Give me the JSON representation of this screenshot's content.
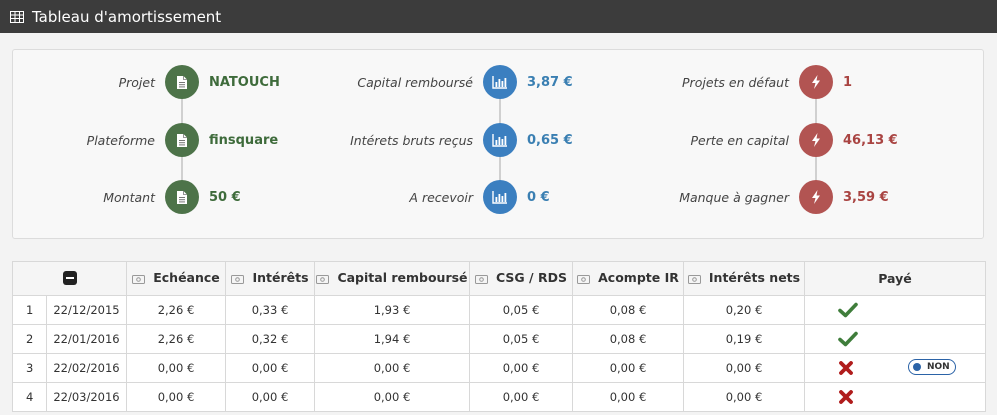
{
  "header": {
    "title": "Tableau d'amortissement"
  },
  "summary": {
    "columns": [
      {
        "color": "#4d7349",
        "value_color": "#3e6b3b",
        "icon": "document-icon",
        "items": [
          {
            "label": "Projet",
            "value": "NATOUCH"
          },
          {
            "label": "Plateforme",
            "value": "finsquare"
          },
          {
            "label": "Montant",
            "value": "50 €"
          }
        ]
      },
      {
        "color": "#3b7fc0",
        "value_color": "#3a7fb2",
        "icon": "bar-chart-icon",
        "items": [
          {
            "label": "Capital remboursé",
            "value": "3,87 €"
          },
          {
            "label": "Intérets bruts reçus",
            "value": "0,65 €"
          },
          {
            "label": "A recevoir",
            "value": "0 €"
          }
        ]
      },
      {
        "color": "#b25452",
        "value_color": "#a94442",
        "icon": "lightning-icon",
        "items": [
          {
            "label": "Projets en défaut",
            "value": "1"
          },
          {
            "label": "Perte en capital",
            "value": "46,13 €"
          },
          {
            "label": "Manque à gagner",
            "value": "3,59 €"
          }
        ]
      }
    ]
  },
  "table": {
    "headers": [
      "Echéance",
      "Intérêts",
      "Capital remboursé",
      "CSG / RDS",
      "Acompte IR",
      "Intérêts nets",
      "Payé"
    ],
    "rows": [
      {
        "n": "1",
        "date": "22/12/2015",
        "echeance": "2,26 €",
        "interets": "0,33 €",
        "capital": "1,93 €",
        "csg": "0,05 €",
        "acompte": "0,08 €",
        "nets": "0,20 €",
        "paid": true
      },
      {
        "n": "2",
        "date": "22/01/2016",
        "echeance": "2,26 €",
        "interets": "0,32 €",
        "capital": "1,94 €",
        "csg": "0,05 €",
        "acompte": "0,08 €",
        "nets": "0,19 €",
        "paid": true
      },
      {
        "n": "3",
        "date": "22/02/2016",
        "echeance": "0,00 €",
        "interets": "0,00 €",
        "capital": "0,00 €",
        "csg": "0,00 €",
        "acompte": "0,00 €",
        "nets": "0,00 €",
        "paid": false,
        "toggle": "NON"
      },
      {
        "n": "4",
        "date": "22/03/2016",
        "echeance": "0,00 €",
        "interets": "0,00 €",
        "capital": "0,00 €",
        "csg": "0,00 €",
        "acompte": "0,00 €",
        "nets": "0,00 €",
        "paid": false
      }
    ]
  },
  "colors": {
    "paid": "#3f7d3b",
    "unpaid": "#b01c1c",
    "toggle": "#2b63a7"
  }
}
